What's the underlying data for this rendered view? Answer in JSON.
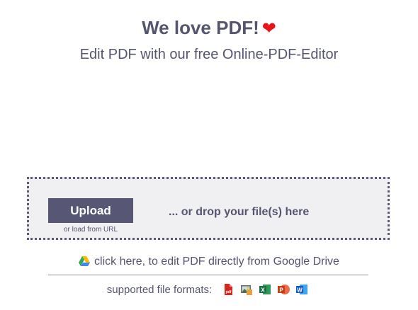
{
  "header": {
    "title": "We love PDF!",
    "heart": "❤",
    "subtitle": "Edit PDF with our free Online-PDF-Editor"
  },
  "dropzone": {
    "upload_label": "Upload",
    "load_url_label": "or load from URL",
    "drop_text": "... or drop your file(s) here"
  },
  "gdrive": {
    "text": "click here, to edit PDF directly from Google Drive",
    "icon": "google-drive-icon"
  },
  "formats": {
    "label": "supported file formats:",
    "icons": [
      "pdf-file-icon",
      "image-file-icon",
      "excel-file-icon",
      "powerpoint-file-icon",
      "word-file-icon"
    ]
  },
  "colors": {
    "text": "#555570",
    "button": "#575775",
    "dropzone_bg": "#f0eff2",
    "heart": "#e8141c"
  }
}
